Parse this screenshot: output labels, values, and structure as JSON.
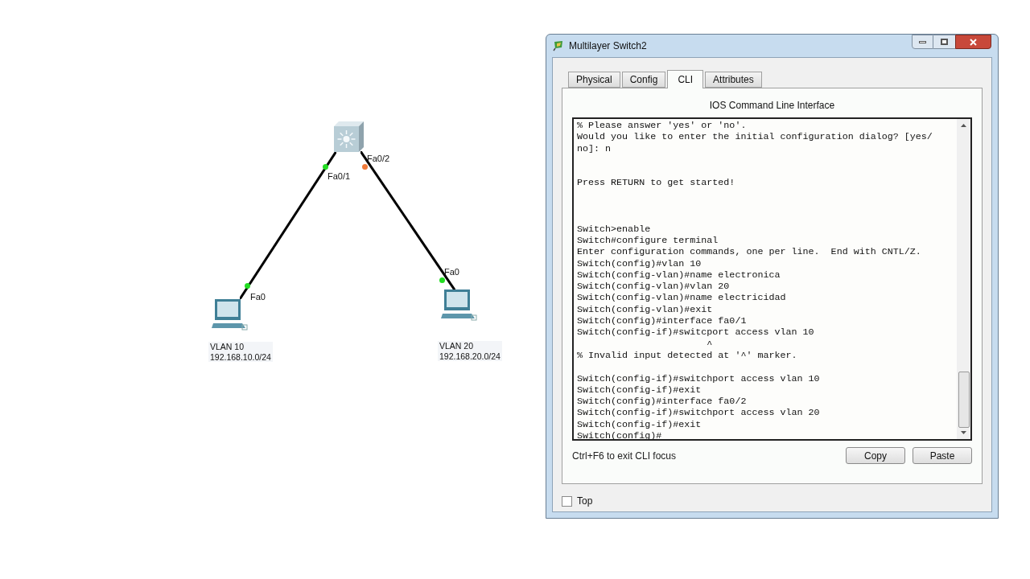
{
  "topology": {
    "switch": {
      "kind": "multilayer-switch"
    },
    "links": [
      {
        "from_port": {
          "label": "Fa0/1",
          "color": "#22dd22"
        },
        "to_port": {
          "label": "Fa0",
          "color": "#22dd22"
        }
      },
      {
        "from_port": {
          "label": "Fa0/2",
          "color": "#f07a3a"
        },
        "to_port": {
          "label": "Fa0",
          "color": "#22dd22"
        }
      }
    ],
    "hosts": [
      {
        "vlan": "VLAN 10",
        "network": "192.168.10.0/24"
      },
      {
        "vlan": "VLAN 20",
        "network": "192.168.20.0/24"
      }
    ]
  },
  "window": {
    "title": "Multilayer Switch2",
    "tabs": [
      {
        "label": "Physical",
        "selected": false
      },
      {
        "label": "Config",
        "selected": false
      },
      {
        "label": "CLI",
        "selected": true
      },
      {
        "label": "Attributes",
        "selected": false
      }
    ],
    "heading": "IOS Command Line Interface",
    "terminal": "% Please answer 'yes' or 'no'.\nWould you like to enter the initial configuration dialog? [yes/\nno]: n\n\n\nPress RETURN to get started!\n\n\n\nSwitch>enable\nSwitch#configure terminal\nEnter configuration commands, one per line.  End with CNTL/Z.\nSwitch(config)#vlan 10\nSwitch(config-vlan)#name electronica\nSwitch(config-vlan)#vlan 20\nSwitch(config-vlan)#name electricidad\nSwitch(config-vlan)#exit\nSwitch(config)#interface fa0/1\nSwitch(config-if)#switcport access vlan 10\n                       ^\n% Invalid input detected at '^' marker.\n\nSwitch(config-if)#switchport access vlan 10\nSwitch(config-if)#exit\nSwitch(config)#interface fa0/2\nSwitch(config-if)#switchport access vlan 20\nSwitch(config-if)#exit\nSwitch(config)#",
    "hint": "Ctrl+F6 to exit CLI focus",
    "buttons": [
      "Copy",
      "Paste"
    ],
    "top": {
      "label": "Top",
      "checked": false
    }
  }
}
